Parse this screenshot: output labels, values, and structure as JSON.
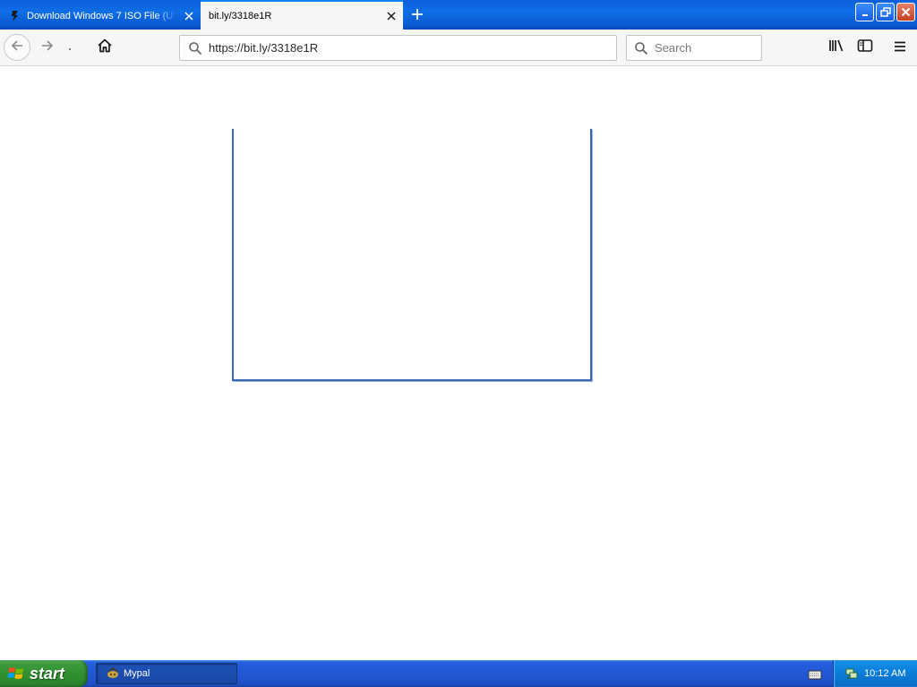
{
  "browser": {
    "tabs": [
      {
        "title": "Download Windows 7 ISO File (U",
        "active": false
      },
      {
        "title": "bit.ly/3318e1R",
        "active": true
      }
    ],
    "url": "https://bit.ly/3318e1R",
    "search_placeholder": "Search"
  },
  "taskbar": {
    "start_label": "start",
    "items": [
      {
        "label": "Mypal"
      }
    ],
    "clock": "10:12 AM"
  },
  "colors": {
    "titlebar": "#0f6ee6",
    "taskbar": "#245edb",
    "start_button": "#3c9a3c",
    "frame_border": "#3a66b0"
  },
  "icons": {
    "tab1": "bolt-favicon-icon",
    "close": "close-icon",
    "new_tab": "plus-icon",
    "back": "arrow-left-icon",
    "forward": "arrow-right-icon",
    "home": "home-icon",
    "search": "search-icon",
    "library": "library-icon",
    "sidebar": "sidebar-icon",
    "menu": "hamburger-menu-icon"
  }
}
